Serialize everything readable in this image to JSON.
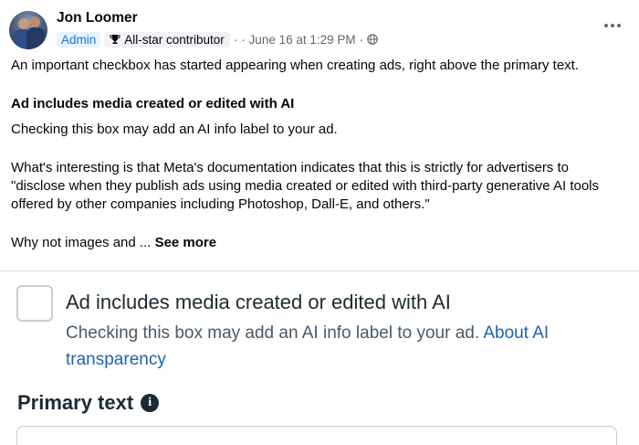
{
  "post": {
    "author": "Jon Loomer",
    "badge_admin": "Admin",
    "badge_contributor": "All-star contributor",
    "dot": "·",
    "timestamp": "· June 16 at 1:29 PM ·",
    "intro": "An important checkbox has started appearing when creating ads, right above the primary text.",
    "heading": "Ad includes media created or edited with AI",
    "checkbox_note": "Checking this box may add an AI info label to your ad.",
    "paragraph": "What's interesting is that Meta's documentation indicates that this is strictly for advertisers to \"disclose when they publish ads using media created or edited with third-party generative AI tools offered by other companies including Photoshop, Dall-E, and others.\"",
    "why_text": "Why not images and ... ",
    "see_more": "See more"
  },
  "embed": {
    "checkbox_label": "Ad includes media created or edited with AI",
    "desc_text": "Checking this box may add an AI info label to your ad. ",
    "link_text": "About AI transparency",
    "primary_text_label": "Primary text",
    "info_glyph": "i"
  },
  "icons": {
    "avatar": "avatar",
    "trophy": "trophy-icon",
    "globe": "globe-icon",
    "more": "more-options-icon",
    "info": "info-icon"
  },
  "colors": {
    "admin_badge_bg": "#e7f3ff",
    "admin_badge_text": "#1b74e4",
    "link": "#1b63b8",
    "meta_text": "#65676b"
  }
}
